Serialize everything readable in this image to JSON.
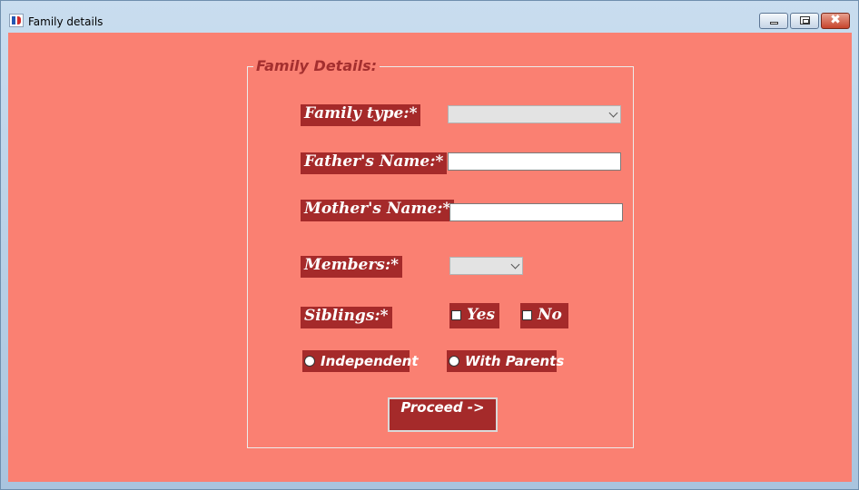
{
  "window": {
    "title": "Family details",
    "icon": "app-logo-icon",
    "controls": {
      "minimize": "minimize-icon",
      "maximize": "restore-icon",
      "close": "✖"
    }
  },
  "form": {
    "legend": "Family Details:",
    "family_type_label": "Family type:*",
    "family_type_value": "",
    "father_label": "Father's Name:*",
    "father_value": "",
    "mother_label": "Mother's Name:*",
    "mother_value": "",
    "members_label": "Members:*",
    "members_value": "",
    "siblings_label": "Siblings:*",
    "siblings_yes": "Yes",
    "siblings_no": "No",
    "radio_independent": "Independent",
    "radio_with_parents": "With Parents",
    "proceed_label": "Proceed ->"
  },
  "colors": {
    "background": "#fa8072",
    "label_bg": "#a52a2a",
    "legend": "#a42f2f"
  }
}
